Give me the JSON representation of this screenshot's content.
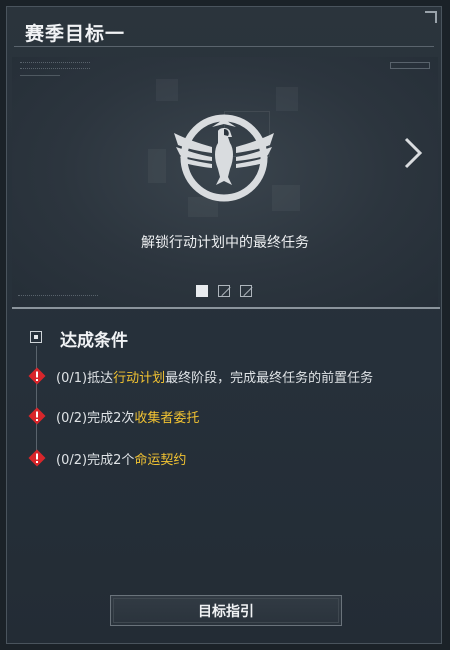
{
  "panel": {
    "title": "赛季目标一"
  },
  "banner": {
    "caption": "解锁行动计划中的最终任务",
    "emblem_icon": "eagle-emblem-icon",
    "next_icon": "chevron-right-icon",
    "pages": {
      "total": 3,
      "current": 1
    }
  },
  "conditions": {
    "title": "达成条件",
    "items": [
      {
        "progress": "(0/1)",
        "pre": "抵达",
        "highlight": "行动计划",
        "post": "最终阶段，完成最终任务的前置任务",
        "icon": "warning-icon"
      },
      {
        "progress": "(0/2)",
        "pre": "完成2次",
        "highlight": "收集者委托",
        "post": "",
        "icon": "warning-icon"
      },
      {
        "progress": "(0/2)",
        "pre": "完成2个",
        "highlight": "命运契约",
        "post": "",
        "icon": "warning-icon"
      }
    ]
  },
  "footer": {
    "guide_label": "目标指引"
  },
  "colors": {
    "highlight": "#f1c232",
    "warning": "#d8262b"
  }
}
